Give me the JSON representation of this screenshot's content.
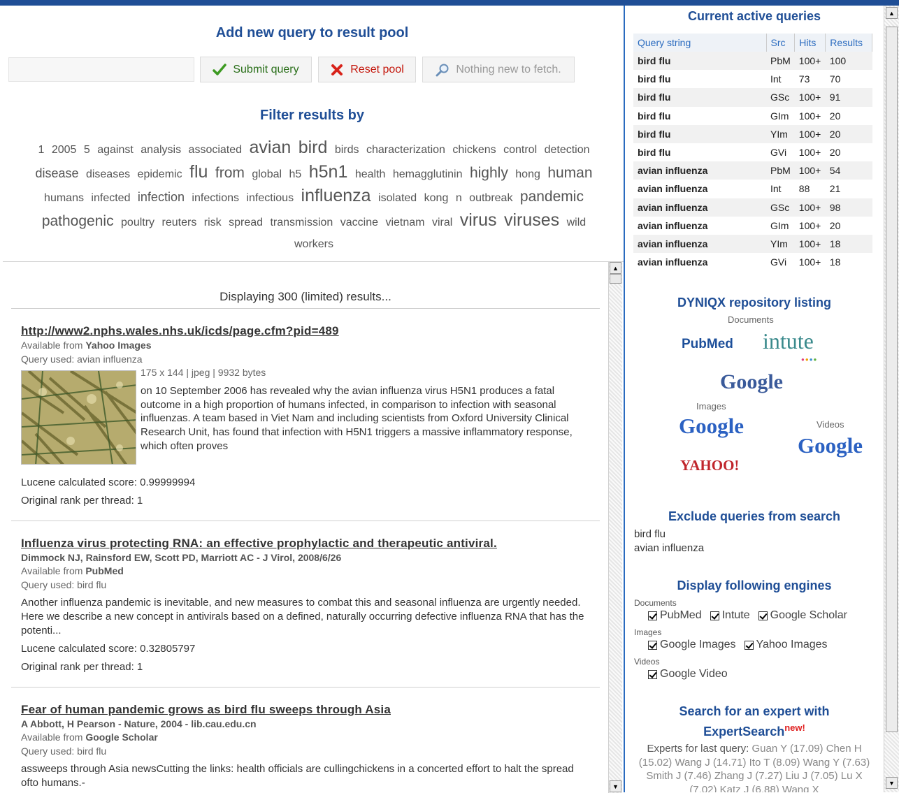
{
  "add_query": {
    "title": "Add new query to result pool",
    "input_value": "",
    "submit_label": "Submit query",
    "reset_label": "Reset pool",
    "fetch_label": "Nothing new to fetch."
  },
  "filter": {
    "title": "Filter results by",
    "tags": [
      {
        "t": "1",
        "s": 1
      },
      {
        "t": "2005",
        "s": 1
      },
      {
        "t": "5",
        "s": 1
      },
      {
        "t": "against",
        "s": 1
      },
      {
        "t": "analysis",
        "s": 1
      },
      {
        "t": "associated",
        "s": 1
      },
      {
        "t": "avian",
        "s": 4
      },
      {
        "t": "bird",
        "s": 4
      },
      {
        "t": "birds",
        "s": 1
      },
      {
        "t": "characterization",
        "s": 1
      },
      {
        "t": "chickens",
        "s": 1
      },
      {
        "t": "control",
        "s": 1
      },
      {
        "t": "detection",
        "s": 1
      },
      {
        "t": "disease",
        "s": 2
      },
      {
        "t": "diseases",
        "s": 1
      },
      {
        "t": "epidemic",
        "s": 1
      },
      {
        "t": "flu",
        "s": 4
      },
      {
        "t": "from",
        "s": 3
      },
      {
        "t": "global",
        "s": 1
      },
      {
        "t": "h5",
        "s": 1
      },
      {
        "t": "h5n1",
        "s": 4
      },
      {
        "t": "health",
        "s": 1
      },
      {
        "t": "hemagglutinin",
        "s": 1
      },
      {
        "t": "highly",
        "s": 3
      },
      {
        "t": "hong",
        "s": 1
      },
      {
        "t": "human",
        "s": 3
      },
      {
        "t": "humans",
        "s": 1
      },
      {
        "t": "infected",
        "s": 1
      },
      {
        "t": "infection",
        "s": 2
      },
      {
        "t": "infections",
        "s": 1
      },
      {
        "t": "infectious",
        "s": 1
      },
      {
        "t": "influenza",
        "s": 4
      },
      {
        "t": "isolated",
        "s": 1
      },
      {
        "t": "kong",
        "s": 1
      },
      {
        "t": "n",
        "s": 1
      },
      {
        "t": "outbreak",
        "s": 1
      },
      {
        "t": "pandemic",
        "s": 3
      },
      {
        "t": "pathogenic",
        "s": 3
      },
      {
        "t": "poultry",
        "s": 1
      },
      {
        "t": "reuters",
        "s": 1
      },
      {
        "t": "risk",
        "s": 1
      },
      {
        "t": "spread",
        "s": 1
      },
      {
        "t": "transmission",
        "s": 1
      },
      {
        "t": "vaccine",
        "s": 1
      },
      {
        "t": "vietnam",
        "s": 1
      },
      {
        "t": "viral",
        "s": 1
      },
      {
        "t": "virus",
        "s": 4
      },
      {
        "t": "viruses",
        "s": 4
      },
      {
        "t": "wild",
        "s": 1
      },
      {
        "t": "workers",
        "s": 1
      }
    ]
  },
  "results": {
    "displaying": "Displaying 300 (limited) results...",
    "r1": {
      "title": "http://www2.nphs.wales.nhs.uk/icds/page.cfm?pid=489",
      "available_prefix": "Available from ",
      "source": "Yahoo Images",
      "query_used": "Query used: avian influenza",
      "dims": "175 x 144 | jpeg | 9932 bytes",
      "text": "on 10 September 2006 has revealed why the avian influenza virus H5N1 produces a fatal outcome in a high proportion of humans infected, in comparison to infection with seasonal influenzas. A team based in Viet Nam and including scientists from Oxford University Clinical Research Unit, has found that infection with H5N1 triggers a massive inflammatory response, which often proves",
      "score": "Lucene calculated score: 0.99999994",
      "rank": "Original rank per thread: 1"
    },
    "r2": {
      "title": "Influenza virus protecting RNA: an effective prophylactic and therapeutic antiviral.",
      "authors": "Dimmock NJ, Rainsford EW, Scott PD, Marriott AC - J Virol, 2008/6/26",
      "available_prefix": "Available from ",
      "source": "PubMed",
      "query_used": "Query used: bird flu",
      "text": "Another influenza pandemic is inevitable, and new measures to combat this and seasonal influenza are urgently needed. Here we describe a new concept in antivirals based on a defined, naturally occurring defective influenza RNA that has the potenti...",
      "score": "Lucene calculated score: 0.32805797",
      "rank": "Original rank per thread: 1"
    },
    "r3": {
      "title": "Fear of human pandemic grows as bird flu sweeps through Asia",
      "authors": "A Abbott, H Pearson - Nature, 2004 - lib.cau.edu.cn",
      "available_prefix": "Available from ",
      "source": "Google Scholar",
      "query_used": "Query used: bird flu",
      "text": "assweeps through Asia newsCutting the links: health officials are cullingchickens in a concerted effort to halt the spread ofto humans.-"
    }
  },
  "active_queries": {
    "title": "Current active queries",
    "headers": [
      "Query string",
      "Src",
      "Hits",
      "Results"
    ],
    "rows": [
      [
        "bird flu",
        "PbM",
        "100+",
        "100"
      ],
      [
        "bird flu",
        "Int",
        "73",
        "70"
      ],
      [
        "bird flu",
        "GSc",
        "100+",
        "91"
      ],
      [
        "bird flu",
        "GIm",
        "100+",
        "20"
      ],
      [
        "bird flu",
        "YIm",
        "100+",
        "20"
      ],
      [
        "bird flu",
        "GVi",
        "100+",
        "20"
      ],
      [
        "avian influenza",
        "PbM",
        "100+",
        "54"
      ],
      [
        "avian influenza",
        "Int",
        "88",
        "21"
      ],
      [
        "avian influenza",
        "GSc",
        "100+",
        "98"
      ],
      [
        "avian influenza",
        "GIm",
        "100+",
        "20"
      ],
      [
        "avian influenza",
        "YIm",
        "100+",
        "18"
      ],
      [
        "avian influenza",
        "GVi",
        "100+",
        "18"
      ]
    ]
  },
  "repository": {
    "title": "DYNIQX repository listing",
    "documents_label": "Documents",
    "images_label": "Images",
    "videos_label": "Videos",
    "logos": {
      "pubmed": "PubMed",
      "intute": "intute",
      "google_scholar": "Google",
      "google_images": "Google",
      "yahoo": "YAHOO!",
      "google_video": "Google"
    }
  },
  "exclude": {
    "title": "Exclude queries from search",
    "items": [
      "bird flu",
      "avian influenza"
    ]
  },
  "engines": {
    "title": "Display following engines",
    "documents_label": "Documents",
    "documents": [
      "PubMed",
      "Intute",
      "Google Scholar"
    ],
    "images_label": "Images",
    "images": [
      "Google Images",
      "Yahoo Images"
    ],
    "videos_label": "Videos",
    "videos": [
      "Google Video"
    ]
  },
  "expert": {
    "title_line1": "Search for an expert with",
    "title_line2": "ExpertSearch",
    "new_badge": "new!",
    "prefix": "Experts for last query:",
    "list": "Guan Y (17.09) Chen H (15.02) Wang J (14.71) Ito T (8.09) Wang Y (7.63) Smith J (7.46) Zhang J (7.27) Liu J (7.05) Lu X (7.02) Katz J (6.88) Wang X"
  },
  "colors": {
    "accent": "#1f4e96",
    "link_blue": "#2a6bbf",
    "submit_green": "#2a6f1a",
    "reset_red": "#c4170c"
  }
}
